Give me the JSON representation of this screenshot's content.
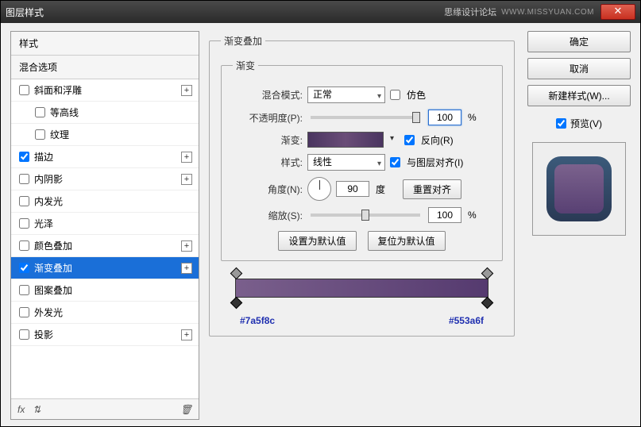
{
  "window": {
    "title": "图层样式",
    "brand": "思缘设计论坛",
    "url": "WWW.MISSYUAN.COM"
  },
  "left": {
    "header_styles": "样式",
    "header_blend": "混合选项",
    "items": [
      {
        "label": "斜面和浮雕",
        "checked": false,
        "plus": true
      },
      {
        "label": "等高线",
        "checked": false,
        "indent": true
      },
      {
        "label": "纹理",
        "checked": false,
        "indent": true
      },
      {
        "label": "描边",
        "checked": true,
        "plus": true
      },
      {
        "label": "内阴影",
        "checked": false,
        "plus": true
      },
      {
        "label": "内发光",
        "checked": false
      },
      {
        "label": "光泽",
        "checked": false
      },
      {
        "label": "颜色叠加",
        "checked": false,
        "plus": true
      },
      {
        "label": "渐变叠加",
        "checked": true,
        "plus": true,
        "selected": true
      },
      {
        "label": "图案叠加",
        "checked": false
      },
      {
        "label": "外发光",
        "checked": false
      },
      {
        "label": "投影",
        "checked": false,
        "plus": true
      }
    ],
    "footer_fx": "fx"
  },
  "center": {
    "fieldset_title": "渐变叠加",
    "inner_title": "渐变",
    "blend_mode_label": "混合模式:",
    "blend_mode_value": "正常",
    "dither_label": "仿色",
    "opacity_label": "不透明度(P):",
    "opacity_value": "100",
    "opacity_unit": "%",
    "gradient_label": "渐变:",
    "reverse_label": "反向(R)",
    "style_label": "样式:",
    "style_value": "线性",
    "align_label": "与图层对齐(I)",
    "angle_label": "角度(N):",
    "angle_value": "90",
    "angle_unit": "度",
    "reset_align": "重置对齐",
    "scale_label": "缩放(S):",
    "scale_value": "100",
    "scale_unit": "%",
    "set_default": "设置为默认值",
    "reset_default": "复位为默认值",
    "hex_left": "#7a5f8c",
    "hex_right": "#553a6f"
  },
  "right": {
    "ok": "确定",
    "cancel": "取消",
    "new_style": "新建样式(W)...",
    "preview_label": "预览(V)"
  }
}
